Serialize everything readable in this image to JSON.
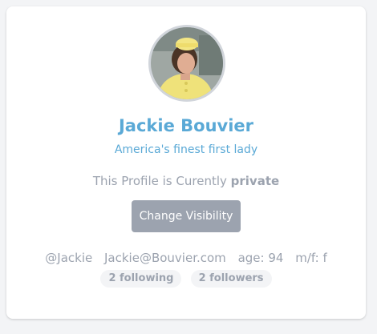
{
  "profile": {
    "name": "Jackie Bouvier",
    "tagline": "America's finest first lady",
    "privacy_prefix": "This Profile is Curently",
    "privacy_state": "private",
    "change_visibility_label": "Change Visibility",
    "handle": "@Jackie",
    "email": "Jackie@Bouvier.com",
    "age": "age: 94",
    "gender": "m/f: f",
    "following": "2 following",
    "followers": "2 followers"
  },
  "colors": {
    "accent": "#5aa9d6",
    "muted": "#9ca3af",
    "button_bg": "#9ca3af",
    "avatar_border": "#d1d5db"
  }
}
